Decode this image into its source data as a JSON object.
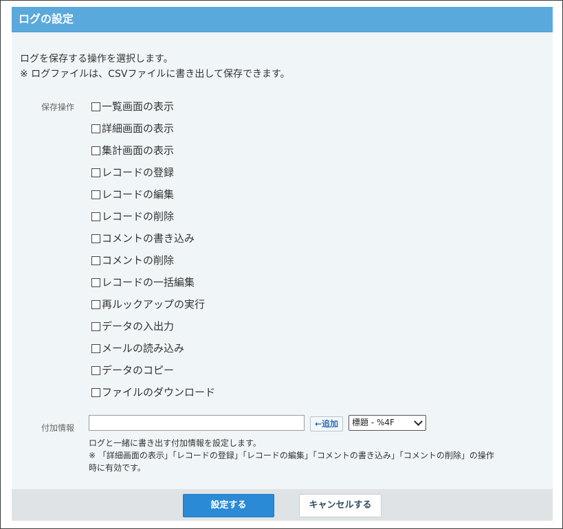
{
  "dialog": {
    "title": "ログの設定",
    "description": [
      "ログを保存する操作を選択します。",
      "※ ログファイルは、CSVファイルに書き出して保存できます。"
    ]
  },
  "operations": {
    "label": "保存操作",
    "items": [
      {
        "label": "一覧画面の表示",
        "checked": false
      },
      {
        "label": "詳細画面の表示",
        "checked": false
      },
      {
        "label": "集計画面の表示",
        "checked": false
      },
      {
        "label": "レコードの登録",
        "checked": false
      },
      {
        "label": "レコードの編集",
        "checked": false
      },
      {
        "label": "レコードの削除",
        "checked": false
      },
      {
        "label": "コメントの書き込み",
        "checked": false
      },
      {
        "label": "コメントの削除",
        "checked": false
      },
      {
        "label": "レコードの一括編集",
        "checked": false
      },
      {
        "label": "再ルックアップの実行",
        "checked": false
      },
      {
        "label": "データの入出力",
        "checked": false
      },
      {
        "label": "メールの読み込み",
        "checked": false
      },
      {
        "label": "データのコピー",
        "checked": false
      },
      {
        "label": "ファイルのダウンロード",
        "checked": false
      }
    ]
  },
  "additional_info": {
    "label": "付加情報",
    "value": "",
    "add_button": "←追加",
    "select_value": "標題 - %4F",
    "help": [
      "ログと一緒に書き出す付加情報を設定します。",
      "※ 「詳細画面の表示」「レコードの登録」「レコードの編集」「コメントの書き込み」「コメントの削除」の操作",
      "時に有効です。"
    ]
  },
  "footer": {
    "save_label": "設定する",
    "cancel_label": "キャンセルする"
  },
  "colors": {
    "header": "#5aa9dd",
    "panel": "#f0f6f8",
    "primary": "#2a8ad6",
    "footer": "#dfe3e5"
  }
}
